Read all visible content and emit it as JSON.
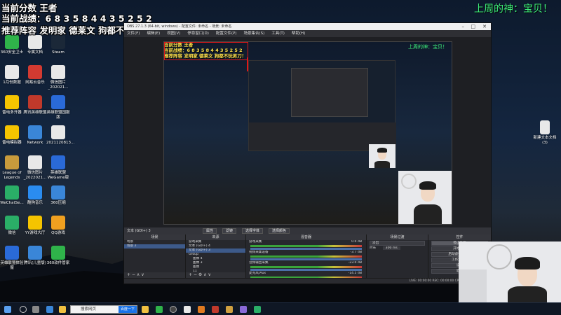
{
  "overlay": {
    "line1": "当前分数 王者",
    "line2": "当前战绩：6 8 3 5 8 4 4 3 5 2 5 2",
    "line3": "推荐阵容 发明家 德莱文 狗都不玩男刀！",
    "weekly_god": "上周的神：宝贝！"
  },
  "desktop_icons": [
    {
      "label": "360安全卫士",
      "color": "#2fb34a"
    },
    {
      "label": "专属文档",
      "color": "#e8e8e8"
    },
    {
      "label": "Steam",
      "color": "#1b2838"
    },
    {
      "label": "1月份数据",
      "color": "#e8e8e8"
    },
    {
      "label": "网易云音乐",
      "color": "#d33a31"
    },
    {
      "label": "微信图片_202021...",
      "color": "#e8e8e8"
    },
    {
      "label": "雷电多开器",
      "color": "#f5c400"
    },
    {
      "label": "腾讯英雄联盟",
      "color": "#c0392b"
    },
    {
      "label": "英雄联盟国服版",
      "color": "#2a6ad8"
    },
    {
      "label": "雷电模拟器",
      "color": "#f5c400"
    },
    {
      "label": "Network",
      "color": "#3a86d8"
    },
    {
      "label": "2021120813...",
      "color": "#e8e8e8"
    },
    {
      "label": "League of Legends",
      "color": "#c89b3c"
    },
    {
      "label": "微信图片_2022021...",
      "color": "#e8e8e8"
    },
    {
      "label": "英雄联盟WeGame版",
      "color": "#2a6ad8"
    },
    {
      "label": "WeChatSe...",
      "color": "#2aae67"
    },
    {
      "label": "酷狗音乐",
      "color": "#2a8cf0"
    },
    {
      "label": "360压缩",
      "color": "#3a86d8"
    },
    {
      "label": "微信",
      "color": "#2aae67"
    },
    {
      "label": "YY游戏大厅",
      "color": "#f5c400"
    },
    {
      "label": "QQ游戏",
      "color": "#f0a020"
    },
    {
      "label": "英雄联盟体验服",
      "color": "#2a6ad8"
    },
    {
      "label": "腾讯(儿童版)",
      "color": "#3a86d8"
    },
    {
      "label": "360软件管家",
      "color": "#2fb34a"
    }
  ],
  "right_desktop_icons": [
    {
      "label": "新建文本文档(3)",
      "color": "#e8e8e8"
    }
  ],
  "obs": {
    "title": "OBS 27.1.3 (64-bit, windows) - 配置文件: 未命名 - 场景: 未命名",
    "menu": [
      "文件(F)",
      "编辑(E)",
      "视图(V)",
      "停靠窗口(D)",
      "配置文件(P)",
      "场景集合(S)",
      "工具(T)",
      "帮助(H)"
    ],
    "source_line": "文本 (GDI+) 3",
    "stat_buttons": [
      "属性",
      "滤镜",
      "选择字体",
      "选择颜色"
    ],
    "scenes": {
      "header": "场景",
      "items": [
        "场景",
        "场景 2"
      ]
    },
    "sources": {
      "header": "来源",
      "items": [
        "游戏采集",
        "文本 (GDI+) 4",
        "文本 (GDI+) 3",
        "Group",
        "图像 4",
        "图像 3",
        "图像",
        "11",
        "音频输出采集"
      ]
    },
    "mixer": {
      "header": "混音器",
      "channels": [
        {
          "name": "游戏采集",
          "db": "0.0 dB"
        },
        {
          "name": "视频采集设备",
          "db": "-3.7 dB"
        },
        {
          "name": "音频输出采集",
          "db": "-23.0 dB"
        },
        {
          "name": "麦克风/Aux",
          "db": "-14.5 dB"
        }
      ]
    },
    "transitions": {
      "header": "场景过渡",
      "type": "淡出",
      "duration_label": "时长",
      "duration": "300 ms"
    },
    "controls": {
      "header": "控件",
      "buttons": [
        "停止推流",
        "开始录制",
        "启动虚拟摄像机",
        "工作室模式",
        "设置",
        "退出"
      ]
    },
    "status": "LIVE: 00:00:00   REC: 00:00:00   CPU: 0.0%, 30.00 fps"
  },
  "taskbar": {
    "search_text": "搜索网页",
    "search_button": "百度一下"
  }
}
